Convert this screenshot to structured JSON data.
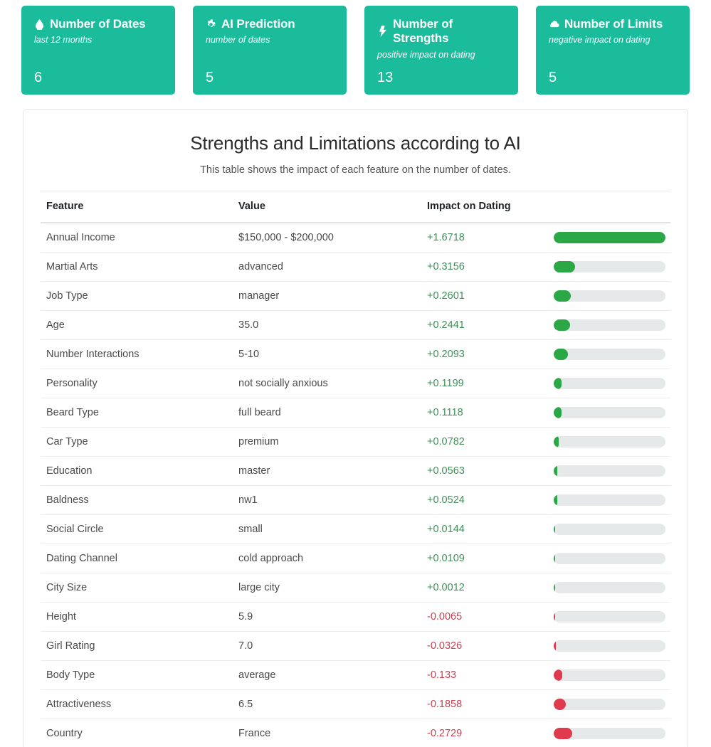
{
  "kpi_cards": [
    {
      "icon": "tint-icon",
      "title": "Number of Dates",
      "subtitle": "last 12 months",
      "value": "6"
    },
    {
      "icon": "gear-icon",
      "title": "AI Prediction",
      "subtitle": "number of dates",
      "value": "5"
    },
    {
      "icon": "bolt-icon",
      "title": "Number of Strengths",
      "subtitle": "positive impact on dating",
      "value": "13"
    },
    {
      "icon": "cloud-icon",
      "title": "Number of Limits",
      "subtitle": "negative impact on dating",
      "value": "5"
    }
  ],
  "panel": {
    "title": "Strengths and Limitations according to AI",
    "subtitle": "This table shows the impact of each feature on the number of dates.",
    "columns": [
      "Feature",
      "Value",
      "Impact on Dating",
      ""
    ]
  },
  "chart_data": {
    "type": "bar",
    "title": "Strengths and Limitations according to AI",
    "xlabel": "Impact on Dating",
    "ylabel": "Feature",
    "orientation": "horizontal",
    "max_abs_value": 1.6718,
    "categories": [
      "Annual Income",
      "Martial Arts",
      "Job Type",
      "Age",
      "Number Interactions",
      "Personality",
      "Beard Type",
      "Car Type",
      "Education",
      "Baldness",
      "Social Circle",
      "Dating Channel",
      "City Size",
      "Height",
      "Girl Rating",
      "Body Type",
      "Attractiveness",
      "Country"
    ],
    "values": [
      1.6718,
      0.3156,
      0.2601,
      0.2441,
      0.2093,
      0.1199,
      0.1118,
      0.0782,
      0.0563,
      0.0524,
      0.0144,
      0.0109,
      0.0012,
      -0.0065,
      -0.0326,
      -0.133,
      -0.1858,
      -0.2729
    ],
    "colors": {
      "positive": "#2ba745",
      "negative": "#e03a4e",
      "track": "#e6e9ea"
    }
  },
  "rows": [
    {
      "feature": "Annual Income",
      "value": "$150,000 - $200,000",
      "impact": "+1.6718",
      "num": 1.6718
    },
    {
      "feature": "Martial Arts",
      "value": "advanced",
      "impact": "+0.3156",
      "num": 0.3156
    },
    {
      "feature": "Job Type",
      "value": "manager",
      "impact": "+0.2601",
      "num": 0.2601
    },
    {
      "feature": "Age",
      "value": "35.0",
      "impact": "+0.2441",
      "num": 0.2441
    },
    {
      "feature": "Number Interactions",
      "value": "5-10",
      "impact": "+0.2093",
      "num": 0.2093
    },
    {
      "feature": "Personality",
      "value": "not socially anxious",
      "impact": "+0.1199",
      "num": 0.1199
    },
    {
      "feature": "Beard Type",
      "value": "full beard",
      "impact": "+0.1118",
      "num": 0.1118
    },
    {
      "feature": "Car Type",
      "value": "premium",
      "impact": "+0.0782",
      "num": 0.0782
    },
    {
      "feature": "Education",
      "value": "master",
      "impact": "+0.0563",
      "num": 0.0563
    },
    {
      "feature": "Baldness",
      "value": "nw1",
      "impact": "+0.0524",
      "num": 0.0524
    },
    {
      "feature": "Social Circle",
      "value": "small",
      "impact": "+0.0144",
      "num": 0.0144
    },
    {
      "feature": "Dating Channel",
      "value": "cold approach",
      "impact": "+0.0109",
      "num": 0.0109
    },
    {
      "feature": "City Size",
      "value": "large city",
      "impact": "+0.0012",
      "num": 0.0012
    },
    {
      "feature": "Height",
      "value": "5.9",
      "impact": "-0.0065",
      "num": -0.0065
    },
    {
      "feature": "Girl Rating",
      "value": "7.0",
      "impact": "-0.0326",
      "num": -0.0326
    },
    {
      "feature": "Body Type",
      "value": "average",
      "impact": "-0.133",
      "num": -0.133
    },
    {
      "feature": "Attractiveness",
      "value": "6.5",
      "impact": "-0.1858",
      "num": -0.1858
    },
    {
      "feature": "Country",
      "value": "France",
      "impact": "-0.2729",
      "num": -0.2729
    }
  ]
}
